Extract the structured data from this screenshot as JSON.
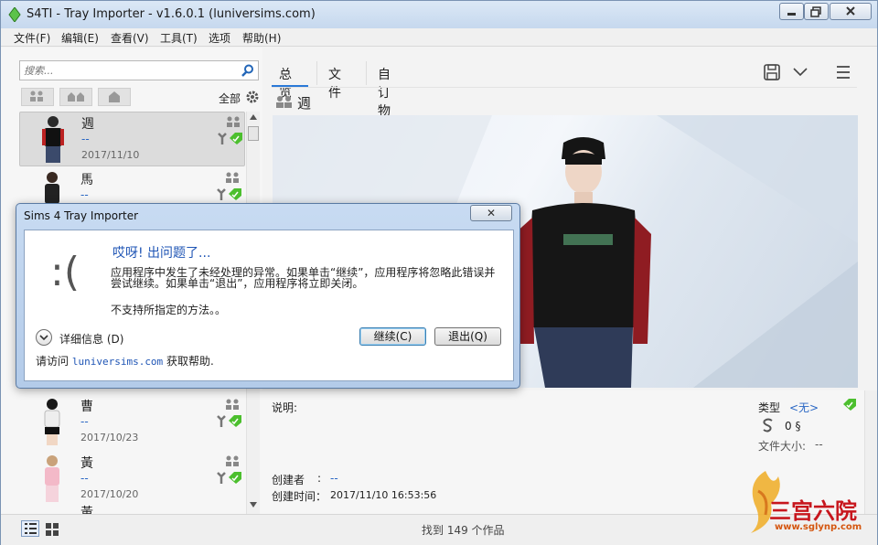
{
  "window": {
    "title": "S4TI - Tray Importer - v1.6.0.1  (luniversims.com)"
  },
  "menu": [
    "文件(F)",
    "编辑(E)",
    "查看(V)",
    "工具(T)",
    "选项",
    "帮助(H)"
  ],
  "search": {
    "placeholder": "搜索..."
  },
  "filter": {
    "all_label": "全部"
  },
  "list": [
    {
      "name": "週",
      "creator": "--",
      "date": "2017/11/10"
    },
    {
      "name": "馬",
      "creator": "--",
      "date": ""
    },
    {
      "name": "曹",
      "creator": "--",
      "date": "2017/10/23"
    },
    {
      "name": "黃",
      "creator": "--",
      "date": "2017/10/20"
    },
    {
      "name": "黃",
      "creator": "",
      "date": ""
    }
  ],
  "tabs": [
    "总览",
    "文件",
    "自订物品"
  ],
  "header": {
    "name": "週"
  },
  "details": {
    "description_label": "说明:",
    "type_label": "类型",
    "type_value": "<无>",
    "simoleons_value": "0 §",
    "filesize_label": "文件大小:",
    "filesize_value": "--",
    "creator_label": "创建者",
    "creator_sep": ":",
    "creator_value": "--",
    "created_label": "创建时间：",
    "created_value": "2017/11/10 16:53:56"
  },
  "status": {
    "found_text": "找到 149 个作品"
  },
  "watermark": {
    "text": "三宫六院",
    "url": "www.sglynp.com"
  },
  "dialog": {
    "title": "Sims 4 Tray Importer",
    "close": "✕",
    "frown": ":(",
    "heading": "哎呀! 出问题了...",
    "message": "应用程序中发生了未经处理的异常。如果单击“继续”，应用程序将忽略此错误并尝试继续。如果单击“退出”，应用程序将立即关闭。",
    "message2": "不支持所指定的方法。。",
    "details_label": "详细信息 (D)",
    "continue_label": "继续(C)",
    "exit_label": "退出(Q)",
    "visit_prefix": "请访问",
    "visit_link": "luniversims.com",
    "visit_suffix": "获取帮助."
  },
  "colors": {
    "accent": "#2a79d7",
    "tag_green": "#4cbf2e",
    "link": "#1f55b5"
  }
}
